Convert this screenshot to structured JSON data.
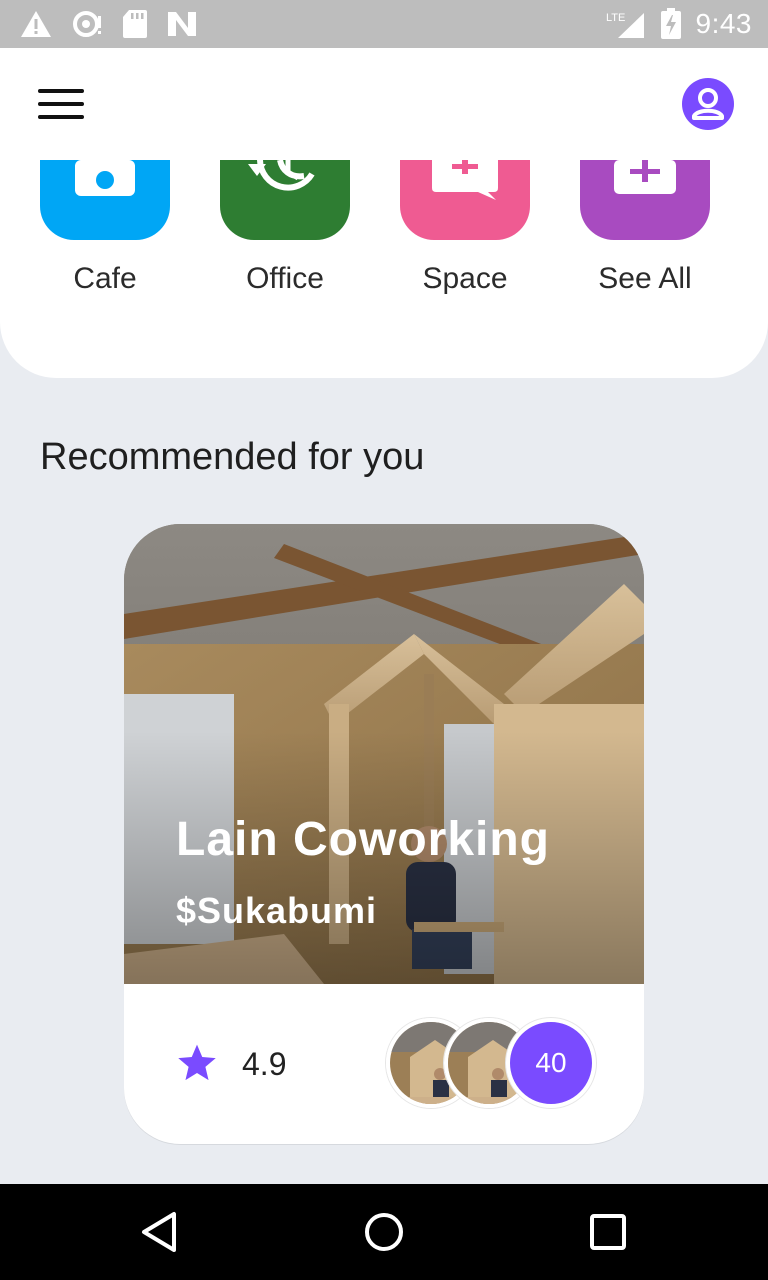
{
  "status_bar": {
    "time": "9:43",
    "network": "LTE",
    "icons": [
      "warning-icon",
      "sync-icon",
      "sd-card-icon",
      "n-logo-icon",
      "signal-icon",
      "battery-charging-icon"
    ]
  },
  "header": {
    "menu_icon": "hamburger-icon",
    "profile_icon": "account-circle-icon"
  },
  "categories": [
    {
      "label": "Cafe",
      "color": "#00A6F5",
      "icon": "cafe-icon"
    },
    {
      "label": "Office",
      "color": "#2E7D32",
      "icon": "office-clock-icon"
    },
    {
      "label": "Space",
      "color": "#EF5B92",
      "icon": "space-chat-icon"
    },
    {
      "label": "See All",
      "color": "#A84BC0",
      "icon": "see-all-icon"
    }
  ],
  "section": {
    "title": "Recommended for you"
  },
  "card": {
    "title": "Lain Coworking",
    "subtitle": "$Sukabumi",
    "rating": "4.9",
    "extra_count": "40",
    "accent_color": "#7A4BFF"
  },
  "nav_bar": {
    "icons": [
      "back-icon",
      "home-icon",
      "recents-icon"
    ]
  }
}
